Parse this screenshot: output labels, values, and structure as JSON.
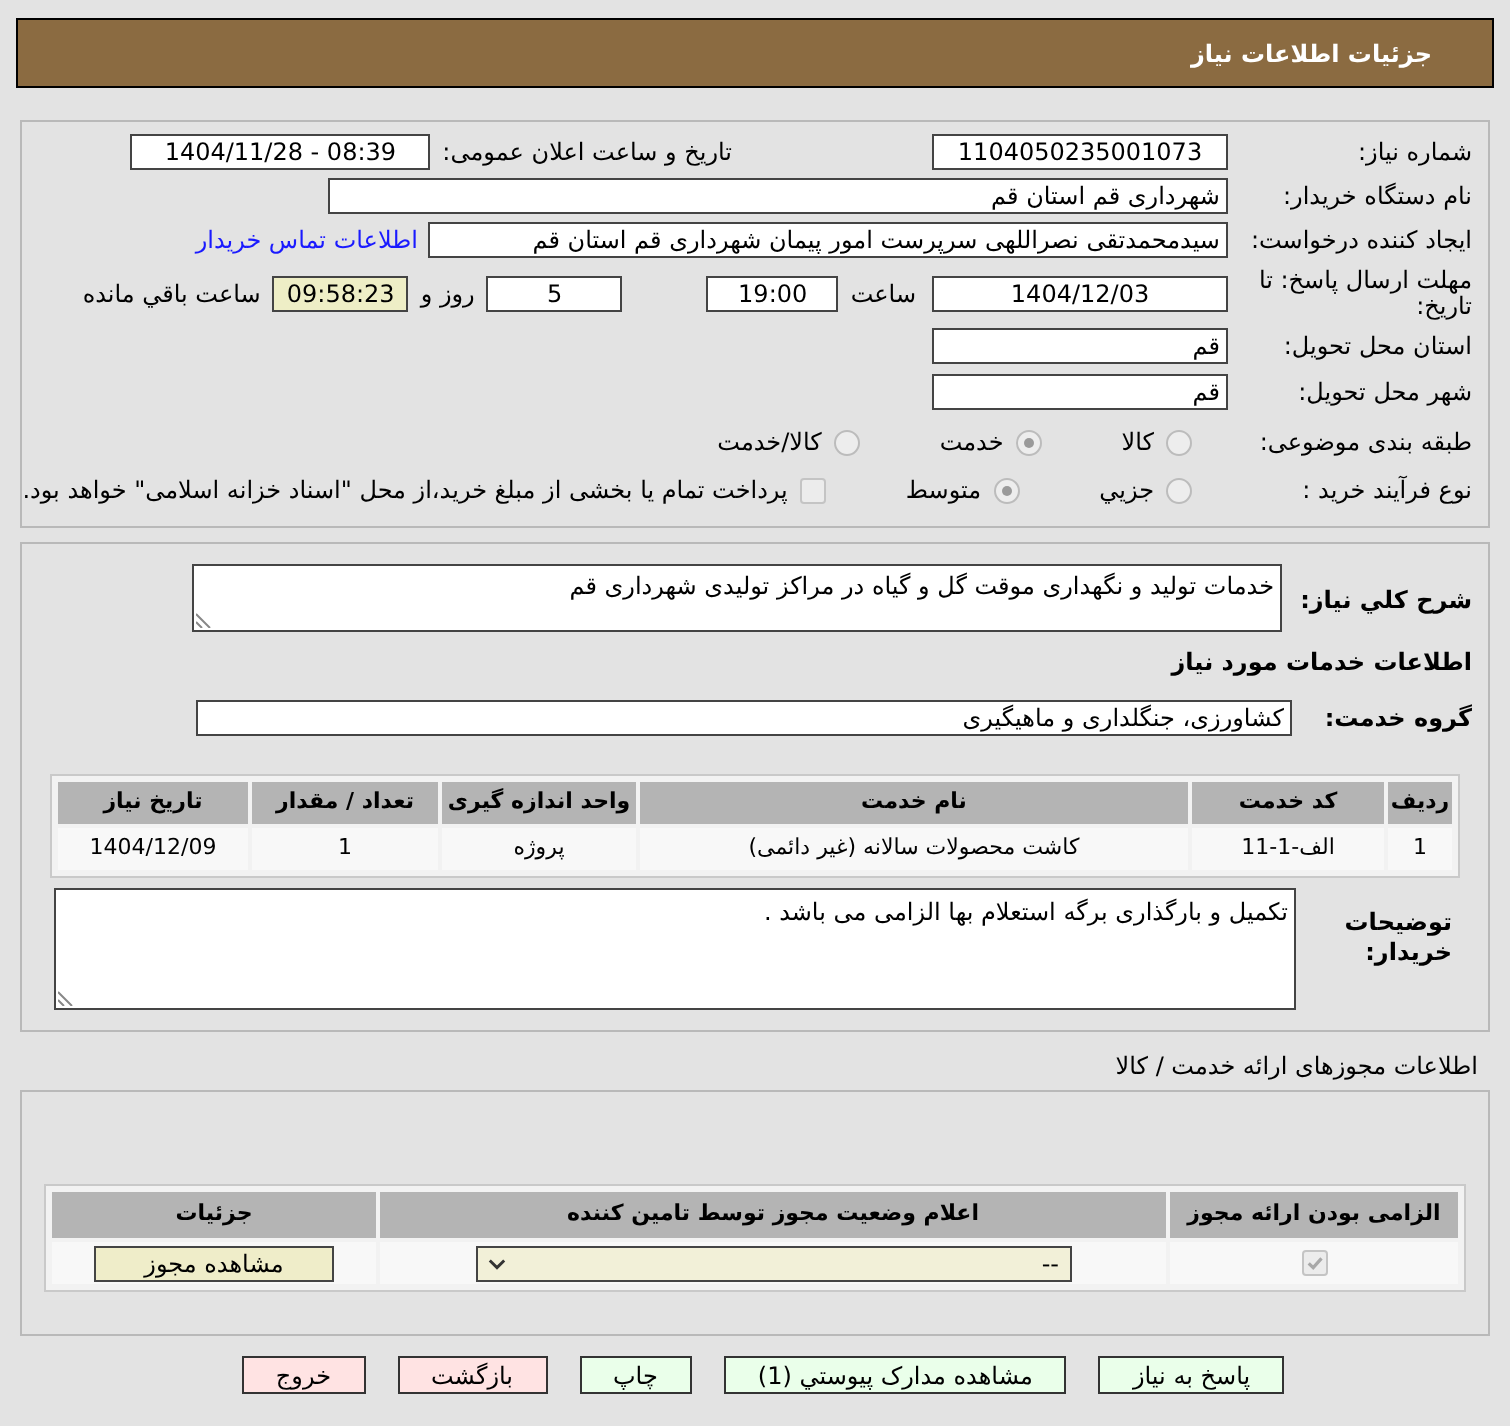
{
  "header": {
    "title": "جزئیات اطلاعات نیاز"
  },
  "summary": {
    "need_number": {
      "label": "شماره نیاز:",
      "value": "1104050235001073"
    },
    "announce": {
      "label": "تاریخ و ساعت اعلان عمومی:",
      "value": "1404/11/28 - 08:39"
    },
    "buyer_org": {
      "label": "نام دستگاه خریدار:",
      "value": "شهرداری قم استان قم"
    },
    "requester": {
      "label": "ایجاد کننده درخواست:",
      "value": "سیدمحمدتقی نصراللهی سرپرست امور پیمان شهرداری قم استان قم",
      "link": "اطلاعات تماس خریدار"
    },
    "deadline": {
      "label": "مهلت ارسال پاسخ: تا تاریخ:",
      "date": "1404/12/03",
      "time_label": "ساعت",
      "time": "19:00",
      "days": "5",
      "days_label": "روز و",
      "remaining": "09:58:23",
      "remaining_label": "ساعت باقي مانده"
    },
    "province": {
      "label": "استان محل تحویل:",
      "value": "قم"
    },
    "city": {
      "label": "شهر محل تحویل:",
      "value": "قم"
    },
    "category": {
      "label": "طبقه بندی موضوعی:",
      "options": [
        {
          "label": "کالا",
          "selected": false
        },
        {
          "label": "خدمت",
          "selected": true
        },
        {
          "label": "کالا/خدمت",
          "selected": false
        }
      ]
    },
    "purchase_type": {
      "label": "نوع فرآیند خرید :",
      "options": [
        {
          "label": "جزيي",
          "selected": false
        },
        {
          "label": "متوسط",
          "selected": true
        }
      ],
      "treasury": {
        "label": "پرداخت تمام یا بخشی از مبلغ خرید،از محل \"اسناد خزانه اسلامی\" خواهد بود.",
        "checked": false
      }
    }
  },
  "need": {
    "description": {
      "label": "شرح کلي نیاز:",
      "value": "خدمات تولید و نگهداری موقت گل و گیاه در مراکز تولیدی شهرداری قم"
    },
    "services_heading": "اطلاعات خدمات مورد نیاز",
    "service_group": {
      "label": "گروه خدمت:",
      "value": "کشاورزی، جنگلداری و ماهیگیری"
    },
    "services_table": {
      "columns": [
        "ردیف",
        "کد خدمت",
        "نام خدمت",
        "واحد اندازه گیری",
        "تعداد / مقدار",
        "تاریخ نیاز"
      ],
      "rows": [
        [
          "1",
          "الف-1-11",
          "کاشت محصولات سالانه (غیر دائمی)",
          "پروژه",
          "1",
          "1404/12/09"
        ]
      ]
    },
    "buyer_notes": {
      "label": "توضیحات خریدار:",
      "value": "تکمیل و بارگذاری برگه استعلام بها الزامی می باشد ."
    }
  },
  "permits": {
    "heading": "اطلاعات مجوزهای ارائه خدمت / کالا",
    "columns": [
      "الزامی بودن ارائه مجوز",
      "اعلام وضعیت مجوز توسط تامین کننده",
      "جزئیات"
    ],
    "rows": [
      {
        "required": true,
        "status": "--",
        "details_button": "مشاهده مجوز"
      }
    ]
  },
  "buttons": [
    {
      "label": "پاسخ به نیاز",
      "kind": "primary"
    },
    {
      "label": "مشاهده مدارک پیوستي (1)",
      "kind": "primary"
    },
    {
      "label": "چاپ",
      "kind": "primary"
    },
    {
      "label": "بازگشت",
      "kind": "danger"
    },
    {
      "label": "خروج",
      "kind": "danger"
    }
  ]
}
